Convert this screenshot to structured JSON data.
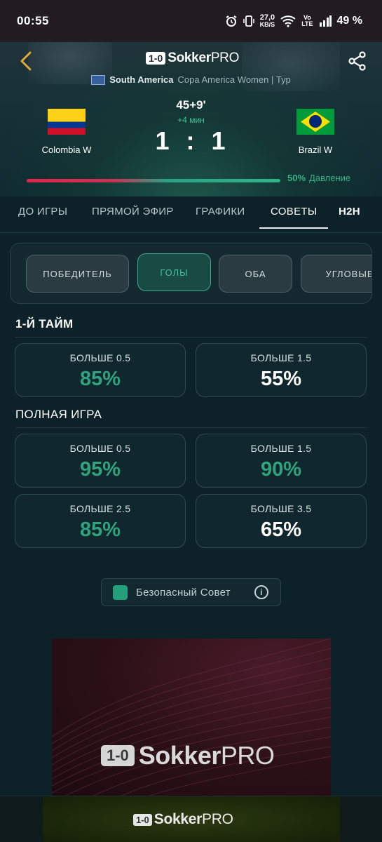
{
  "status_bar": {
    "time": "00:55",
    "speed_value": "27,0",
    "speed_unit": "KB/S",
    "volte_top": "Vo",
    "volte_bottom": "LTE",
    "battery": "49 %"
  },
  "header": {
    "logo_badge": "1-0",
    "logo_name": "Sokker",
    "logo_suffix": "PRO",
    "region": "South America",
    "league": "Copa America Women | Тур",
    "home_team": "Colombia W",
    "away_team": "Brazil W",
    "match_time": "45+9'",
    "added_time": "+4 мин",
    "home_score": "1",
    "score_separator": ":",
    "away_score": "1",
    "pressure_value": "50%",
    "pressure_label": "Давление",
    "pressure_fraction": 0.5
  },
  "tabs": [
    {
      "label": "ДО ИГРЫ"
    },
    {
      "label": "ПРЯМОЙ ЭФИР"
    },
    {
      "label": "ГРАФИКИ"
    },
    {
      "label": "СОВЕТЫ"
    },
    {
      "label": "H2H"
    }
  ],
  "active_tab": "СОВЕТЫ",
  "filters": [
    {
      "label": "ПОБЕДИТЕЛЬ"
    },
    {
      "label": "ГОЛЫ"
    },
    {
      "label": "ОБА"
    },
    {
      "label": "УГЛОВЫЕ"
    }
  ],
  "active_filter": "ГОЛЫ",
  "first_half": {
    "title": "1-Й ТАЙМ",
    "cards": [
      {
        "label": "БОЛЬШЕ 0.5",
        "value": "85%",
        "color": "#2ea37e"
      },
      {
        "label": "БОЛЬШЕ 1.5",
        "value": "55%",
        "color": "#ffffff"
      }
    ]
  },
  "full_game": {
    "title": "ПОЛНАЯ ИГРА",
    "cards": [
      {
        "label": "БОЛЬШЕ 0.5",
        "value": "95%",
        "color": "#2ea37e"
      },
      {
        "label": "БОЛЬШЕ 1.5",
        "value": "90%",
        "color": "#2ea37e"
      },
      {
        "label": "БОЛЬШЕ 2.5",
        "value": "85%",
        "color": "#2ea37e"
      },
      {
        "label": "БОЛЬШЕ 3.5",
        "value": "65%",
        "color": "#ffffff"
      }
    ]
  },
  "safe_tip": {
    "label": "Безопасный Совет",
    "info_glyph": "i"
  },
  "ad": {
    "badge": "1-0",
    "name": "Sokker",
    "suffix": "PRO"
  },
  "bottom_banner": {
    "badge": "1-0",
    "name": "Sokker",
    "suffix": "PRO"
  },
  "colors": {
    "accent_green": "#2ea37e",
    "home_pressure": "#e0264d",
    "away_pressure": "#31b589",
    "background": "#0d2128"
  }
}
